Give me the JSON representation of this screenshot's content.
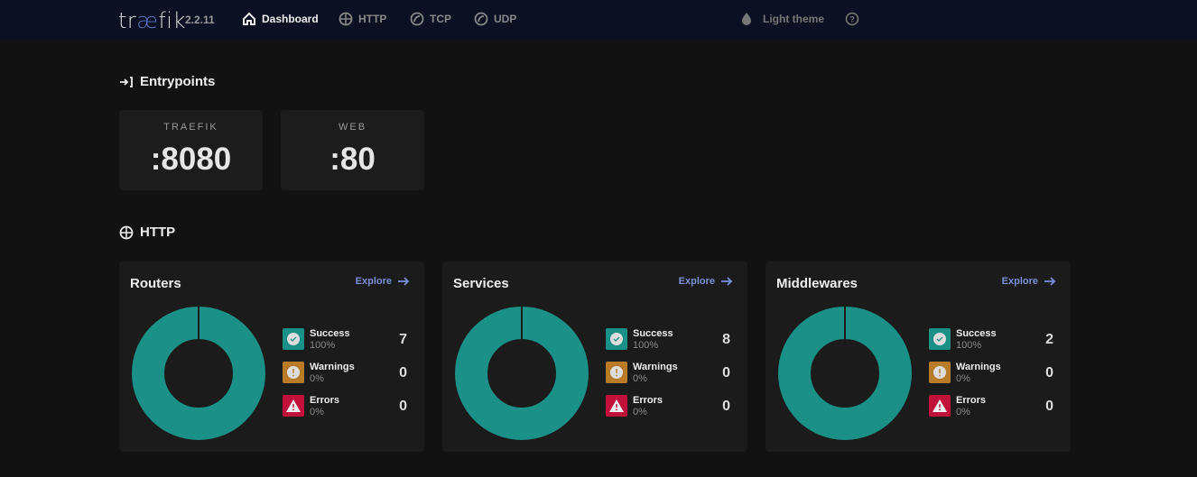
{
  "header": {
    "logo": "træfik",
    "version": "2.2.11",
    "nav": [
      {
        "label": "Dashboard",
        "icon": "home-icon"
      },
      {
        "label": "HTTP",
        "icon": "globe-icon"
      },
      {
        "label": "TCP",
        "icon": "tcp-icon"
      },
      {
        "label": "UDP",
        "icon": "udp-icon"
      }
    ],
    "theme_label": "Light theme"
  },
  "entrypoints": {
    "title": "Entrypoints",
    "items": [
      {
        "name": "TRAEFIK",
        "address": ":8080"
      },
      {
        "name": "WEB",
        "address": ":80"
      }
    ]
  },
  "http": {
    "title": "HTTP",
    "explore_label": "Explore",
    "cards": [
      {
        "title": "Routers",
        "success": {
          "label": "Success",
          "pct": "100%",
          "count": "7"
        },
        "warnings": {
          "label": "Warnings",
          "pct": "0%",
          "count": "0"
        },
        "errors": {
          "label": "Errors",
          "pct": "0%",
          "count": "0"
        }
      },
      {
        "title": "Services",
        "success": {
          "label": "Success",
          "pct": "100%",
          "count": "8"
        },
        "warnings": {
          "label": "Warnings",
          "pct": "0%",
          "count": "0"
        },
        "errors": {
          "label": "Errors",
          "pct": "0%",
          "count": "0"
        }
      },
      {
        "title": "Middlewares",
        "success": {
          "label": "Success",
          "pct": "100%",
          "count": "2"
        },
        "warnings": {
          "label": "Warnings",
          "pct": "0%",
          "count": "0"
        },
        "errors": {
          "label": "Errors",
          "pct": "0%",
          "count": "0"
        }
      }
    ]
  },
  "colors": {
    "success": "#1a9087",
    "warning": "#b87b27",
    "error": "#c1113a",
    "header": "#0b1022"
  }
}
